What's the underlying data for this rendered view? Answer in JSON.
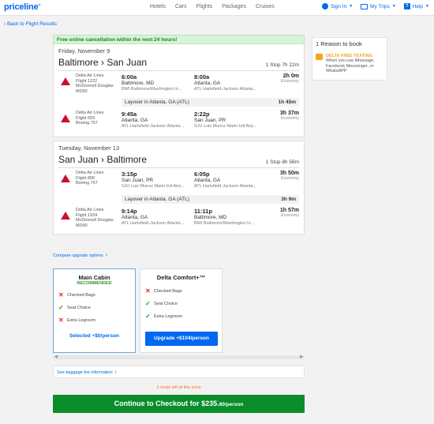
{
  "header": {
    "logo": "priceline",
    "logo_sup": "®",
    "nav": [
      "Hotels",
      "Cars",
      "Flights",
      "Packages",
      "Cruises"
    ],
    "sign_in": "Sign In",
    "my_trips": "My Trips",
    "help": "Help"
  },
  "back_link": "‹ Back to Flight Results",
  "banner": "Free online cancellation within the next 24 hours!",
  "outbound": {
    "date": "Friday, November 9",
    "route": "Baltimore › San Juan",
    "stops": "1 Stop",
    "total": "7h 22m",
    "legs": [
      {
        "airline": "Delta Air Lines",
        "flight": "Flight 1222",
        "aircraft": "McDonnell Douglas MD90",
        "dep_time": "6:00a",
        "dep_city": "Baltimore, MD",
        "dep_airport": "BWI Baltimore/Washington In...",
        "arr_time": "8:00a",
        "arr_city": "Atlanta, GA",
        "arr_airport": "ATL Hartsfield-Jackson Atlanta...",
        "duration": "2h 0m",
        "cabin": "Economy"
      },
      {
        "airline": "Delta Air Lines",
        "flight": "Flight 559",
        "aircraft": "Boeing 757",
        "dep_time": "9:45a",
        "dep_city": "Atlanta, GA",
        "dep_airport": "ATL Hartsfield-Jackson Atlanta...",
        "arr_time": "2:22p",
        "arr_city": "San Juan, PR",
        "arr_airport": "SJU Luis Munoz Marin Intl Airp...",
        "duration": "3h 37m",
        "cabin": "Economy"
      }
    ],
    "layover": "Layover in Atlanta, GA (ATL)",
    "layover_time": "1h 45m"
  },
  "return": {
    "date": "Tuesday, November 13",
    "route": "San Juan › Baltimore",
    "stops": "1 Stop",
    "total": "8h 56m",
    "legs": [
      {
        "airline": "Delta Air Lines",
        "flight": "Flight 806",
        "aircraft": "Boeing 757",
        "dep_time": "3:15p",
        "dep_city": "San Juan, PR",
        "dep_airport": "SJU Luis Munoz Marin Intl Airp...",
        "arr_time": "6:05p",
        "arr_city": "Atlanta, GA",
        "arr_airport": "ATL Hartsfield-Jackson Atlanta...",
        "duration": "3h 50m",
        "cabin": "Economy"
      },
      {
        "airline": "Delta Air Lines",
        "flight": "Flight 1924",
        "aircraft": "McDonnell Douglas MD90",
        "dep_time": "9:14p",
        "dep_city": "Atlanta, GA",
        "dep_airport": "ATL Hartsfield-Jackson Atlanta...",
        "arr_time": "11:11p",
        "arr_city": "Baltimore, MD",
        "arr_airport": "BWI Baltimore/Washington In...",
        "duration": "1h 57m",
        "cabin": "Economy"
      }
    ],
    "layover": "Layover in Atlanta, GA (ATL)",
    "layover_time": "3h 9m"
  },
  "side": {
    "title": "1 Reason to book",
    "reason_title": "DELTA FREE TEXTING",
    "reason_text": "When you use iMessage, Facebook Messenger, or WhatsAPP"
  },
  "upgrade": {
    "compare": "Compare upgrade options",
    "main": {
      "title": "Main Cabin",
      "badge": "RECOMMENDED",
      "features": [
        "Checked Bags",
        "Seat Choice",
        "Extra Legroom"
      ],
      "button": "Selected +$0/person"
    },
    "comfort": {
      "title": "Delta Comfort+™",
      "features": [
        "Checked Bags",
        "Seat Choice",
        "Extra Legroom"
      ],
      "button": "Upgrade +$104/person"
    }
  },
  "baggage_link": "See baggage fee information",
  "seats_left": "3 seats left at this price",
  "checkout": {
    "label": "Continue to Checkout for $235.",
    "cents": "80/person"
  },
  "colors": {
    "brand": "#0068ef",
    "checkout": "#0a8d2b",
    "delta": "#c8102e",
    "accent": "#f9a31b"
  }
}
